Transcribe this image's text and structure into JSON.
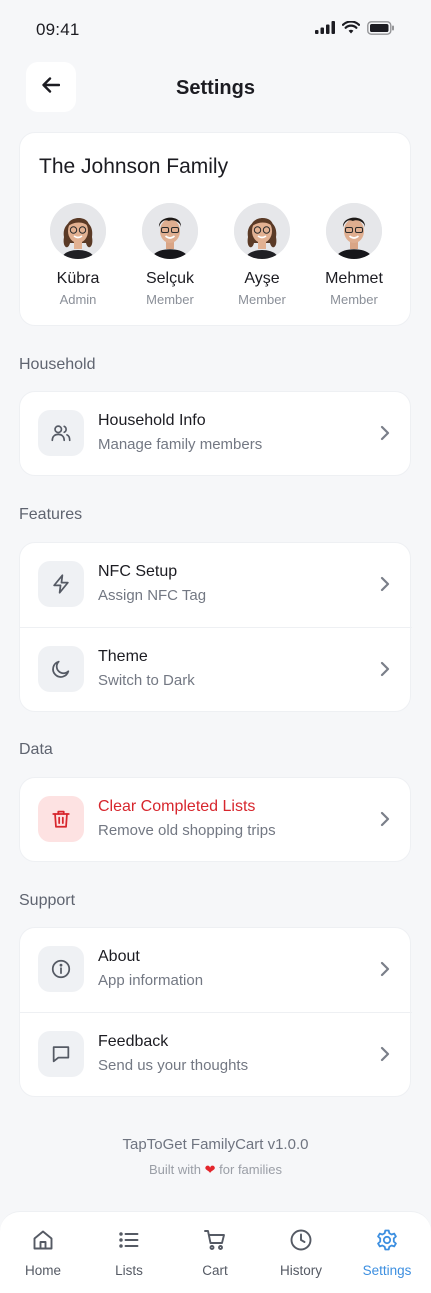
{
  "status_bar": {
    "time": "09:41"
  },
  "header": {
    "title": "Settings",
    "back_icon": "arrow-left-icon"
  },
  "family": {
    "name": "The Johnson Family",
    "members": [
      {
        "name": "Kübra",
        "role": "Admin",
        "avatar": "female-avatar"
      },
      {
        "name": "Selçuk",
        "role": "Member",
        "avatar": "male-avatar"
      },
      {
        "name": "Ayşe",
        "role": "Member",
        "avatar": "female-avatar"
      },
      {
        "name": "Mehmet",
        "role": "Member",
        "avatar": "male-avatar"
      }
    ]
  },
  "sections": {
    "household": {
      "title": "Household",
      "items": [
        {
          "title": "Household Info",
          "subtitle": "Manage family members",
          "icon": "users-icon"
        }
      ]
    },
    "features": {
      "title": "Features",
      "items": [
        {
          "title": "NFC Setup",
          "subtitle": "Assign NFC Tag",
          "icon": "lightning-icon"
        },
        {
          "title": "Theme",
          "subtitle": "Switch to Dark",
          "icon": "moon-icon"
        }
      ]
    },
    "data": {
      "title": "Data",
      "items": [
        {
          "title": "Clear Completed Lists",
          "subtitle": "Remove old shopping trips",
          "icon": "trash-icon"
        }
      ]
    },
    "support": {
      "title": "Support",
      "items": [
        {
          "title": "About",
          "subtitle": "App information",
          "icon": "info-icon"
        },
        {
          "title": "Feedback",
          "subtitle": "Send us your thoughts",
          "icon": "message-icon"
        }
      ]
    }
  },
  "footer": {
    "version": "TapToGet FamilyCart v1.0.0",
    "built_prefix": "Built with",
    "built_suffix": "for families"
  },
  "tabs": [
    {
      "label": "Home",
      "icon": "home-icon"
    },
    {
      "label": "Lists",
      "icon": "list-icon"
    },
    {
      "label": "Cart",
      "icon": "cart-icon"
    },
    {
      "label": "History",
      "icon": "clock-icon"
    },
    {
      "label": "Settings",
      "icon": "gear-icon",
      "active": true
    }
  ],
  "colors": {
    "accent": "#3d8fe0",
    "danger": "#d7262d",
    "background": "#f6f7f9"
  }
}
